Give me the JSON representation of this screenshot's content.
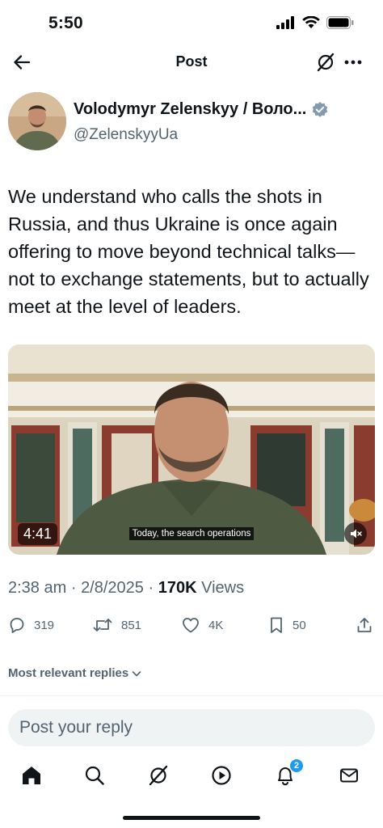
{
  "status_bar": {
    "time": "5:50"
  },
  "nav": {
    "title": "Post"
  },
  "author": {
    "name": "Volodymyr Zelenskyy / Воло...",
    "handle": "@ZelenskyyUa",
    "verified_color": "#829aab"
  },
  "tweet": {
    "text": "We understand who calls the shots in Russia, and thus Ukraine is once again offering to move beyond technical talks—not to exchange statements, but to actually meet at the level of leaders."
  },
  "media": {
    "duration": "4:41",
    "caption": "Today, the search operations"
  },
  "meta": {
    "time": "2:38 am",
    "date": "2/8/2025",
    "views_count": "170K",
    "views_label": "Views",
    "separator": "·"
  },
  "actions": {
    "replies": "319",
    "reposts": "851",
    "likes": "4K",
    "bookmarks": "50"
  },
  "replies_sort": {
    "label": "Most relevant replies"
  },
  "reply_input": {
    "placeholder": "Post your reply"
  },
  "tabbar": {
    "notifications_badge": "2",
    "accent": "#1d9bf0"
  },
  "icons": [
    "back-arrow-icon",
    "grok-icon",
    "more-icon",
    "verified-icon",
    "reply-icon",
    "repost-icon",
    "like-icon",
    "bookmark-icon",
    "share-icon",
    "home-icon",
    "search-icon",
    "play-icon",
    "bell-icon",
    "mail-icon",
    "mute-icon",
    "chevron-down-icon"
  ]
}
